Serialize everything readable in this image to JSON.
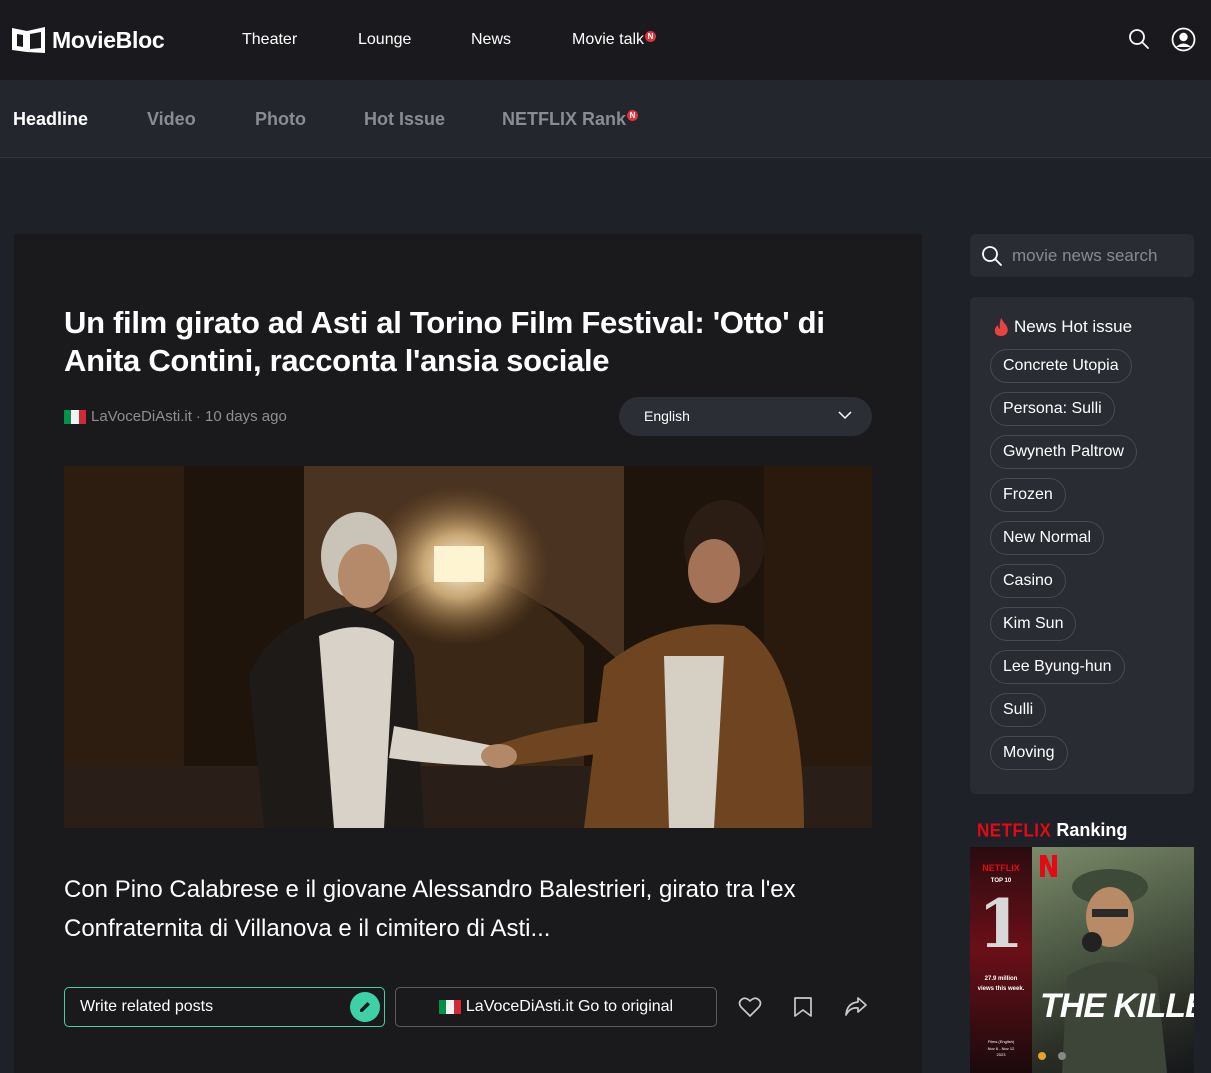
{
  "brand": {
    "name": "MovieBloc"
  },
  "topnav": {
    "items": [
      {
        "label": "Theater",
        "badge": ""
      },
      {
        "label": "Lounge",
        "badge": ""
      },
      {
        "label": "News",
        "badge": ""
      },
      {
        "label": "Movie talk",
        "badge": "N"
      }
    ]
  },
  "subnav": {
    "items": [
      {
        "label": "Headline",
        "active": true,
        "badge": ""
      },
      {
        "label": "Video",
        "active": false,
        "badge": ""
      },
      {
        "label": "Photo",
        "active": false,
        "badge": ""
      },
      {
        "label": "Hot Issue",
        "active": false,
        "badge": ""
      },
      {
        "label": "NETFLIX Rank",
        "active": false,
        "badge": "N"
      }
    ]
  },
  "article": {
    "title": "Un film girato ad Asti al Torino Film Festival: 'Otto' di Anita Contini, racconta l'ansia sociale",
    "source": "LaVoceDiAsti.it",
    "time": "· 10 days ago",
    "language": "English",
    "summary": "Con Pino Calabrese e il giovane Alessandro Balestrieri, girato tra l'ex Confraternita di Villanova e il cimitero di Asti...",
    "write_label": "Write related posts",
    "original_label": "LaVoceDiAsti.it Go to original"
  },
  "search": {
    "placeholder": "movie news search"
  },
  "hot_issue": {
    "title": "News Hot issue",
    "tags": [
      "Concrete Utopia",
      "Persona: Sulli",
      "Gwyneth Paltrow",
      "Frozen",
      "New Normal",
      "Casino",
      "Kim Sun",
      "Lee Byung-hun",
      "Sulli",
      "Moving"
    ]
  },
  "ranking": {
    "brand": "NETFLIX",
    "title": "Ranking",
    "card": {
      "logo_small": "NETFLIX",
      "top_label": "TOP 10",
      "rank": "1",
      "views": "27.9 million views this week.",
      "category": "Films (English)",
      "dates": "Nov 6 - Nov 12 2023",
      "poster_title": "THE KILLER"
    }
  },
  "colors": {
    "accent": "#3ed1a8",
    "badge": "#e0323b",
    "netflix": "#e50914",
    "flag_green": "#009246",
    "flag_white": "#f1f2f1",
    "flag_red": "#ce2b37"
  }
}
